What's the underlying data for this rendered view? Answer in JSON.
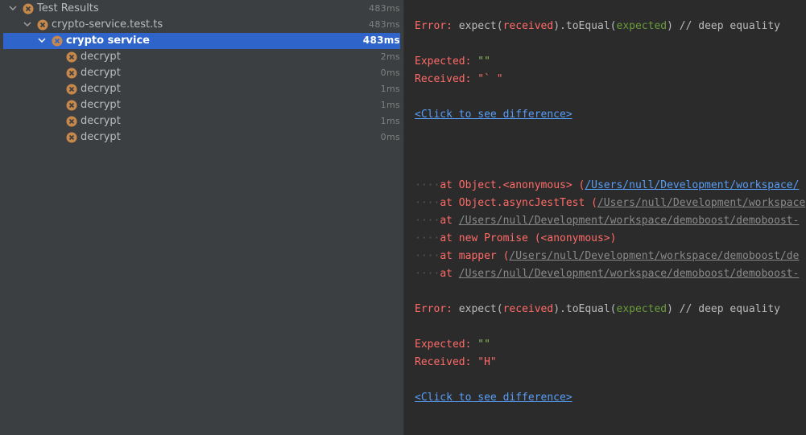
{
  "tree": {
    "items": [
      {
        "label": "Test Results",
        "duration": "483ms"
      },
      {
        "label": "crypto-service.test.ts",
        "duration": "483ms"
      },
      {
        "label": "crypto service",
        "duration": "483ms"
      },
      {
        "label": "decrypt",
        "duration": "2ms"
      },
      {
        "label": "decrypt",
        "duration": "0ms"
      },
      {
        "label": "decrypt",
        "duration": "1ms"
      },
      {
        "label": "decrypt",
        "duration": "1ms"
      },
      {
        "label": "decrypt",
        "duration": "1ms"
      },
      {
        "label": "decrypt",
        "duration": "0ms"
      }
    ]
  },
  "console": {
    "error1": {
      "prefix": "Error: ",
      "a": "expect(",
      "b": "received",
      "c": ").toEqual(",
      "d": "expected",
      "e": ") // deep equality"
    },
    "expected1": {
      "label": "Expected: ",
      "value": "\"\""
    },
    "received1": {
      "label": "Received: ",
      "value": "\"` \""
    },
    "diff_link1": "<Click to see difference>",
    "stack": {
      "dots": "····",
      "l1": {
        "at": "at Object.<anonymous> (",
        "path": "/Users/null/Development/workspace/"
      },
      "l2": {
        "at": "at Object.asyncJestTest (",
        "path": "/Users/null/Development/workspace"
      },
      "l3": {
        "at": "at ",
        "path": "/Users/null/Development/workspace/demoboost/demoboost-"
      },
      "l4": {
        "at": "at new Promise (<anonymous>)"
      },
      "l5": {
        "at": "at mapper (",
        "path": "/Users/null/Development/workspace/demoboost/de"
      },
      "l6": {
        "at": "at ",
        "path": "/Users/null/Development/workspace/demoboost/demoboost-"
      }
    },
    "error2": {
      "prefix": "Error: ",
      "a": "expect(",
      "b": "received",
      "c": ").toEqual(",
      "d": "expected",
      "e": ") // deep equality"
    },
    "expected2": {
      "label": "Expected: ",
      "value": "\"\""
    },
    "received2": {
      "label": "Received: ",
      "value": "\"H\""
    },
    "diff_link2": "<Click to see difference>"
  },
  "colors": {
    "tree_bg": "#3c3f41",
    "console_bg": "#2b2b2b",
    "selection": "#2f65ca",
    "fail_icon": "#c7884a",
    "error_red": "#ff6b68",
    "link_blue": "#589df6",
    "green": "#6a9c3d"
  },
  "icons": {
    "status": "failed-test-icon",
    "expand": "chevron-down-icon"
  }
}
